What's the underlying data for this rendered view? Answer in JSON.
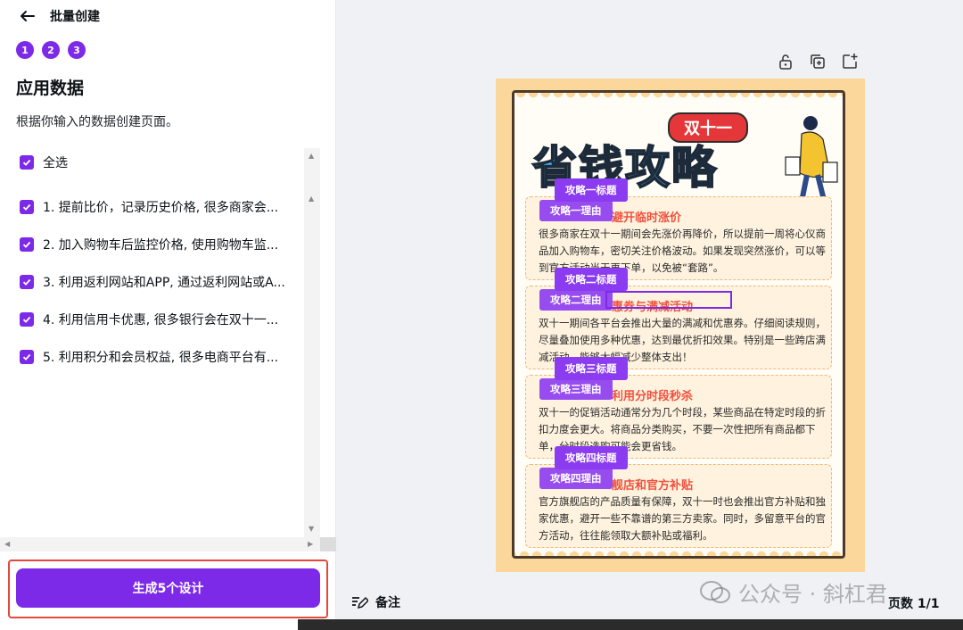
{
  "panel": {
    "title": "批量创建",
    "steps": [
      "1",
      "2",
      "3"
    ],
    "heading": "应用数据",
    "description": "根据你输入的数据创建页面。",
    "select_all": "全选",
    "items": [
      "1. 提前比价，记录历史价格, 很多商家会...",
      "2. 加入购物车后监控价格, 使用购物车监...",
      "3. 利用返利网站和APP, 通过返利网站或A...",
      "4. 利用信用卡优惠, 很多银行会在双十一...",
      "5. 利用积分和会员权益, 很多电商平台有..."
    ],
    "generate_label": "生成5个设计"
  },
  "poster": {
    "badge": "双十一",
    "title_part1": "省",
    "title_part2": "钱",
    "title_part3": "攻略",
    "cards": [
      {
        "tag_title": "攻略一标题",
        "tag_reason": "攻略一理由",
        "heading": "避开临时涨价",
        "body": "很多商家在双十一期间会先涨价再降价，所以提前一周将心仪商品加入购物车，密切关注价格波动。如果发现突然涨价，可以等到官方活动当天再下单，以免被“套路”。"
      },
      {
        "tag_title": "攻略二标题",
        "tag_reason": "攻略二理由",
        "heading": "惠券与满减活动",
        "body": "双十一期间各平台会推出大量的满减和优惠券。仔细阅读规则，尽量叠加使用多种优惠，达到最优折扣效果。特别是一些跨店满减活动，能够大幅减少整体支出！"
      },
      {
        "tag_title": "攻略三标题",
        "tag_reason": "攻略三理由",
        "heading": "利用分时段秒杀",
        "body": "双十一的促销活动通常分为几个时段，某些商品在特定时段的折扣力度会更大。将商品分类购买，不要一次性把所有商品都下单，分时段选购可能会更省钱。"
      },
      {
        "tag_title": "攻略四标题",
        "tag_reason": "攻略四理由",
        "heading": "舰店和官方补贴",
        "body": "官方旗舰店的产品质量有保障，双十一时也会推出官方补贴和独家优惠，避开一些不靠谱的第三方卖家。同时，多留意平台的官方活动，往往能领取大额补贴或福利。"
      }
    ]
  },
  "footer": {
    "notes_label": "备注",
    "watermark": "公众号 · 斜杠君",
    "page_count": "页数 1/1"
  },
  "colors": {
    "accent": "#7d2ae8",
    "highlight_border": "#e5483b",
    "poster_bg": "#fbd79b"
  }
}
